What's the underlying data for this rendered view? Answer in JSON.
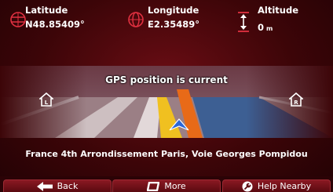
{
  "latitude": {
    "label": "Latitude",
    "value": "N48.85409°"
  },
  "longitude": {
    "label": "Longitude",
    "value": "E2.35489°"
  },
  "altitude": {
    "label": "Altitude",
    "value": "0",
    "unit": "m"
  },
  "map": {
    "status": "GPS position is current"
  },
  "address": "France 4th Arrondissement Paris, Voie Georges Pompidou",
  "toolbar": {
    "back_label": "Back",
    "more_label": "More",
    "help_label": "Help Nearby"
  },
  "icons": {
    "latitude": "globe-latitude-icon",
    "longitude": "globe-longitude-icon",
    "altitude": "altitude-icon",
    "home_left": "home-left-icon",
    "home_right": "home-right-icon",
    "back": "arrow-left-icon",
    "more": "more-icon",
    "help": "wrench-icon",
    "position": "position-arrow-icon"
  },
  "colors": {
    "background": "#3c0508",
    "accent": "#d8283a",
    "button": "#7a1520"
  }
}
